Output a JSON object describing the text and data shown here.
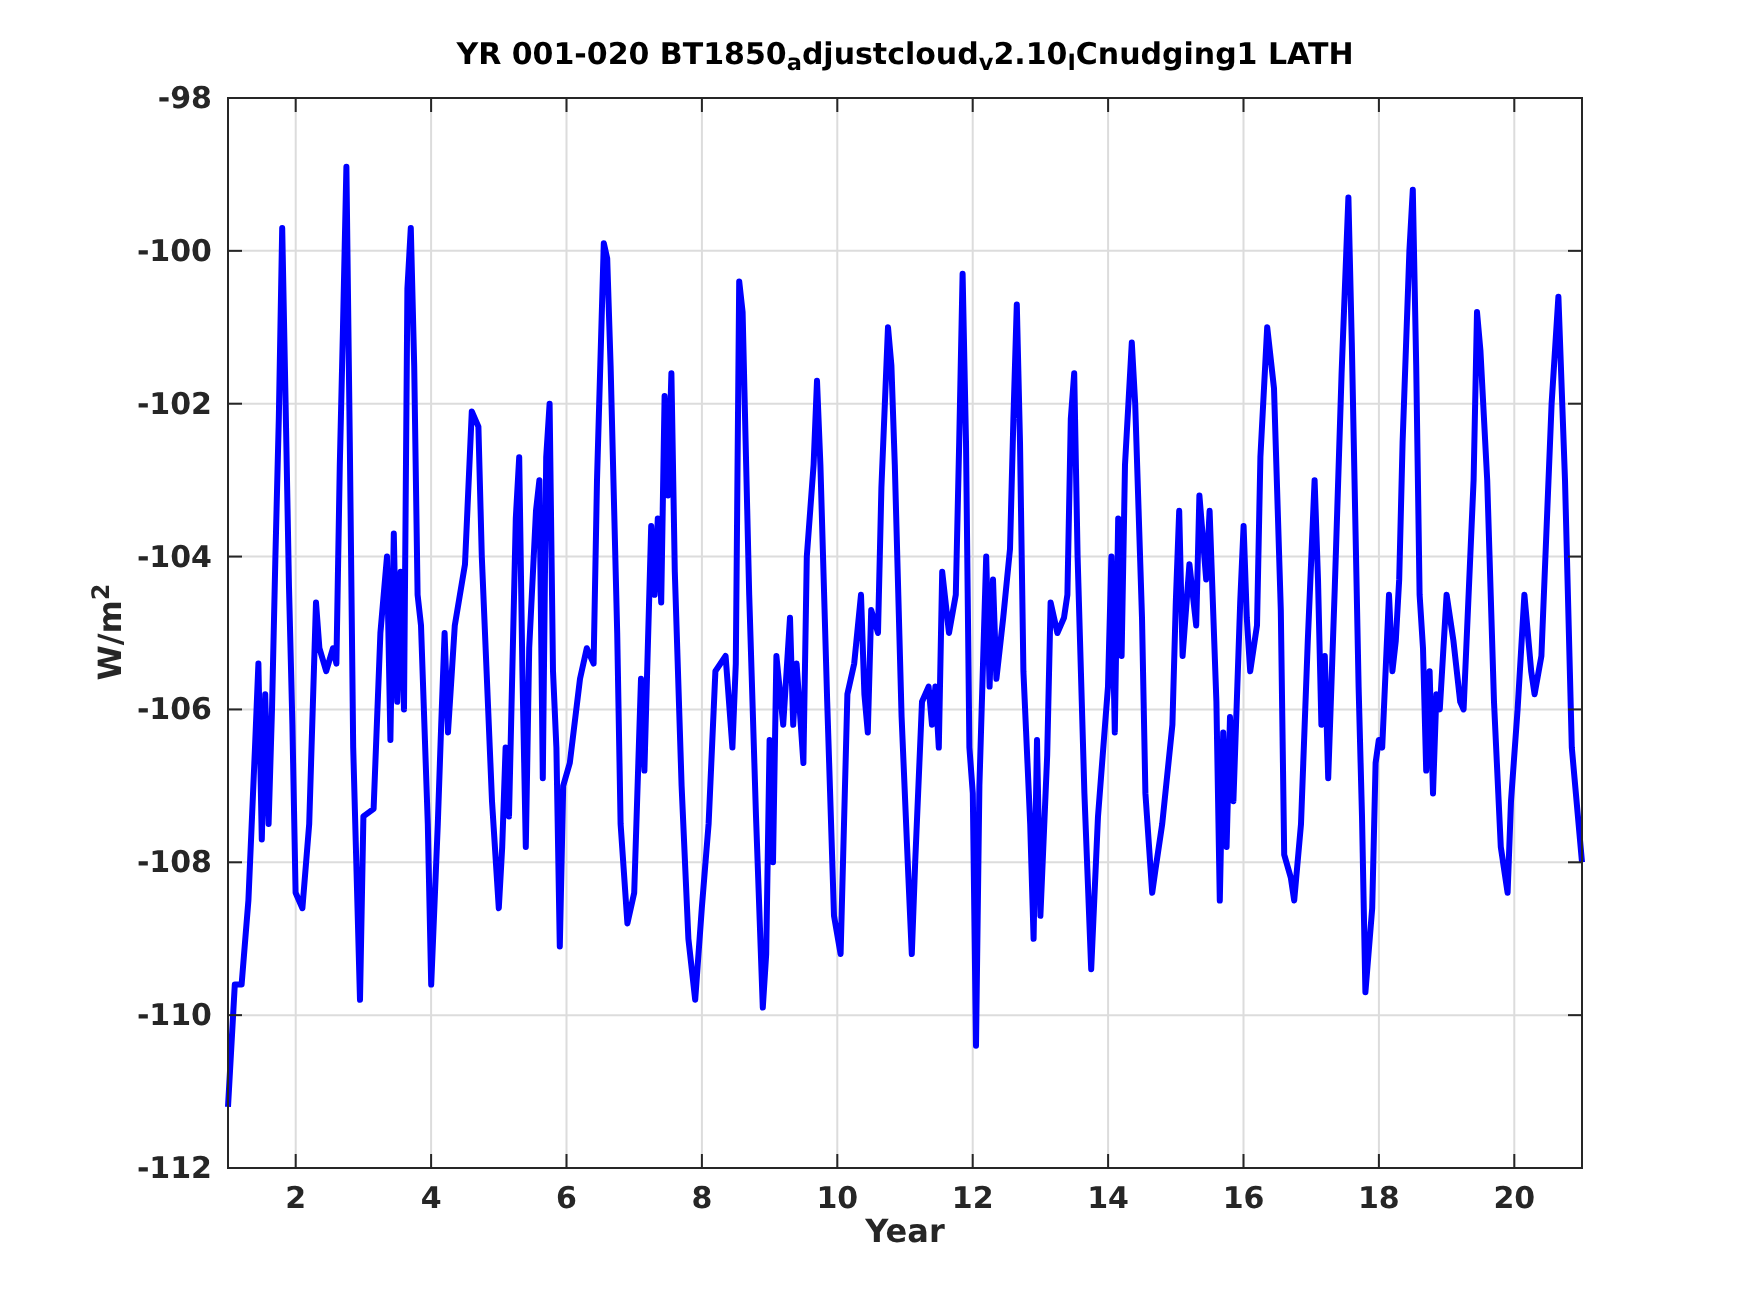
{
  "figure": {
    "chart_data": {
      "type": "line",
      "grid": true,
      "title": "YR 001-020 BT1850$_{a}$djustcloud$_{v}$2.10$_{I}$Cnudging1 LATH",
      "xlabel": "Year",
      "ylabel": "W/m$^{2}$",
      "xlim": [
        1,
        21
      ],
      "ylim": [
        -112,
        -98
      ],
      "xticks": [
        2,
        4,
        6,
        8,
        10,
        12,
        14,
        16,
        18,
        20
      ],
      "yticks": [
        -112,
        -110,
        -108,
        -106,
        -104,
        -102,
        -100,
        -98
      ],
      "x": [
        1.0,
        1.1,
        1.2,
        1.3,
        1.4,
        1.45,
        1.5,
        1.55,
        1.6,
        1.65,
        1.7,
        1.75,
        1.8,
        1.85,
        1.9,
        1.95,
        2.0,
        2.1,
        2.2,
        2.3,
        2.35,
        2.45,
        2.55,
        2.6,
        2.65,
        2.7,
        2.75,
        2.8,
        2.85,
        2.95,
        3.0,
        3.15,
        3.25,
        3.35,
        3.4,
        3.45,
        3.5,
        3.55,
        3.6,
        3.65,
        3.7,
        3.75,
        3.8,
        3.85,
        3.95,
        4.0,
        4.1,
        4.15,
        4.2,
        4.25,
        4.35,
        4.5,
        4.6,
        4.7,
        4.75,
        4.9,
        5.0,
        5.05,
        5.1,
        5.15,
        5.25,
        5.3,
        5.35,
        5.4,
        5.45,
        5.55,
        5.6,
        5.65,
        5.7,
        5.75,
        5.8,
        5.85,
        5.9,
        5.95,
        6.05,
        6.2,
        6.3,
        6.4,
        6.45,
        6.55,
        6.6,
        6.65,
        6.75,
        6.8,
        6.9,
        7.0,
        7.1,
        7.15,
        7.25,
        7.3,
        7.35,
        7.4,
        7.45,
        7.5,
        7.55,
        7.6,
        7.7,
        7.8,
        7.9,
        8.0,
        8.1,
        8.2,
        8.35,
        8.45,
        8.5,
        8.55,
        8.6,
        8.7,
        8.8,
        8.9,
        8.95,
        9.0,
        9.05,
        9.1,
        9.2,
        9.3,
        9.35,
        9.4,
        9.5,
        9.55,
        9.65,
        9.7,
        9.75,
        9.85,
        9.95,
        10.05,
        10.15,
        10.25,
        10.35,
        10.4,
        10.45,
        10.5,
        10.6,
        10.65,
        10.75,
        10.8,
        10.85,
        10.95,
        11.05,
        11.1,
        11.15,
        11.25,
        11.35,
        11.4,
        11.45,
        11.5,
        11.55,
        11.65,
        11.75,
        11.8,
        11.85,
        11.9,
        11.95,
        12.0,
        12.05,
        12.1,
        12.2,
        12.25,
        12.3,
        12.35,
        12.45,
        12.55,
        12.6,
        12.65,
        12.7,
        12.75,
        12.85,
        12.9,
        12.95,
        13.0,
        13.1,
        13.15,
        13.25,
        13.35,
        13.4,
        13.45,
        13.5,
        13.55,
        13.65,
        13.75,
        13.85,
        14.0,
        14.05,
        14.1,
        14.15,
        14.2,
        14.25,
        14.35,
        14.4,
        14.5,
        14.55,
        14.65,
        14.7,
        14.8,
        14.95,
        15.0,
        15.05,
        15.1,
        15.2,
        15.3,
        15.35,
        15.45,
        15.5,
        15.6,
        15.65,
        15.7,
        15.75,
        15.8,
        15.85,
        15.95,
        16.0,
        16.05,
        16.1,
        16.2,
        16.25,
        16.35,
        16.45,
        16.55,
        16.6,
        16.7,
        16.75,
        16.85,
        16.95,
        17.05,
        17.1,
        17.15,
        17.2,
        17.25,
        17.35,
        17.45,
        17.55,
        17.6,
        17.7,
        17.75,
        17.8,
        17.9,
        17.95,
        18.0,
        18.05,
        18.15,
        18.2,
        18.25,
        18.3,
        18.35,
        18.45,
        18.5,
        18.55,
        18.6,
        18.65,
        18.7,
        18.75,
        18.8,
        18.85,
        18.9,
        19.0,
        19.1,
        19.2,
        19.25,
        19.4,
        19.45,
        19.5,
        19.6,
        19.7,
        19.8,
        19.9,
        19.95,
        20.05,
        20.15,
        20.25,
        20.3,
        20.4,
        20.55,
        20.65,
        20.75,
        20.85,
        21.0
      ],
      "series": [
        {
          "color": "#0000ff",
          "values": [
            -111.2,
            -109.6,
            -109.6,
            -108.5,
            -106.5,
            -105.4,
            -107.7,
            -105.8,
            -107.5,
            -106.0,
            -104.0,
            -102.2,
            -99.7,
            -102.0,
            -104.4,
            -106.2,
            -108.4,
            -108.6,
            -107.5,
            -104.6,
            -105.2,
            -105.5,
            -105.2,
            -105.4,
            -102.8,
            -101.0,
            -98.9,
            -102.5,
            -106.5,
            -109.8,
            -107.4,
            -107.3,
            -105.0,
            -104.0,
            -106.4,
            -103.7,
            -105.9,
            -104.2,
            -106.0,
            -100.5,
            -99.7,
            -101.5,
            -104.5,
            -104.9,
            -107.5,
            -109.6,
            -107.5,
            -106.2,
            -105.0,
            -106.3,
            -104.9,
            -104.1,
            -102.1,
            -102.3,
            -104.0,
            -107.2,
            -108.6,
            -107.8,
            -106.5,
            -107.4,
            -103.5,
            -102.7,
            -105.5,
            -107.8,
            -105.2,
            -103.4,
            -103.0,
            -106.9,
            -102.7,
            -102.0,
            -105.5,
            -106.5,
            -109.1,
            -107.0,
            -106.7,
            -105.6,
            -105.2,
            -105.4,
            -103.0,
            -99.9,
            -100.1,
            -101.5,
            -105.0,
            -107.5,
            -108.8,
            -108.4,
            -105.6,
            -106.8,
            -103.6,
            -104.5,
            -103.5,
            -104.6,
            -101.9,
            -103.2,
            -101.6,
            -104.2,
            -107.0,
            -109.0,
            -109.8,
            -108.6,
            -107.5,
            -105.5,
            -105.3,
            -106.5,
            -105.4,
            -100.4,
            -100.8,
            -104.5,
            -107.4,
            -109.9,
            -109.2,
            -106.4,
            -108.0,
            -105.3,
            -106.2,
            -104.8,
            -106.2,
            -105.4,
            -106.7,
            -104.0,
            -102.8,
            -101.7,
            -102.8,
            -105.9,
            -108.7,
            -109.2,
            -105.8,
            -105.4,
            -104.5,
            -105.8,
            -106.3,
            -104.7,
            -105.0,
            -103.1,
            -101.0,
            -101.5,
            -102.8,
            -106.1,
            -108.2,
            -109.2,
            -108.0,
            -105.9,
            -105.7,
            -106.2,
            -105.7,
            -106.5,
            -104.2,
            -105.0,
            -104.5,
            -102.5,
            -100.3,
            -102.5,
            -106.5,
            -107.1,
            -110.4,
            -107.0,
            -104.0,
            -105.7,
            -104.3,
            -105.6,
            -104.8,
            -103.9,
            -102.2,
            -100.7,
            -102.5,
            -105.5,
            -107.5,
            -109.0,
            -106.4,
            -108.7,
            -106.6,
            -104.6,
            -105.0,
            -104.8,
            -104.5,
            -102.2,
            -101.6,
            -104.0,
            -107.1,
            -109.4,
            -107.4,
            -105.7,
            -104.0,
            -106.3,
            -103.5,
            -105.3,
            -102.8,
            -101.2,
            -102.0,
            -104.8,
            -107.1,
            -108.4,
            -108.1,
            -107.5,
            -106.2,
            -104.6,
            -103.4,
            -105.3,
            -104.1,
            -104.9,
            -103.2,
            -104.3,
            -103.4,
            -105.9,
            -108.5,
            -106.3,
            -107.8,
            -106.1,
            -107.2,
            -104.6,
            -103.6,
            -104.8,
            -105.5,
            -104.9,
            -102.7,
            -101.0,
            -101.8,
            -104.7,
            -107.9,
            -108.2,
            -108.5,
            -107.5,
            -105.1,
            -103.0,
            -104.3,
            -106.2,
            -105.3,
            -106.9,
            -104.4,
            -101.6,
            -99.3,
            -101.2,
            -105.7,
            -107.4,
            -109.7,
            -108.6,
            -106.7,
            -106.4,
            -106.5,
            -104.5,
            -105.5,
            -105.1,
            -104.3,
            -102.5,
            -100.0,
            -99.2,
            -101.5,
            -104.5,
            -105.2,
            -106.8,
            -105.5,
            -107.1,
            -105.8,
            -106.0,
            -104.5,
            -105.1,
            -105.9,
            -106.0,
            -103.0,
            -100.8,
            -101.3,
            -103.0,
            -105.9,
            -107.8,
            -108.4,
            -107.2,
            -106.0,
            -104.5,
            -105.5,
            -105.8,
            -105.3,
            -102.0,
            -100.6,
            -103.0,
            -106.5,
            -108.0
          ]
        }
      ]
    }
  }
}
